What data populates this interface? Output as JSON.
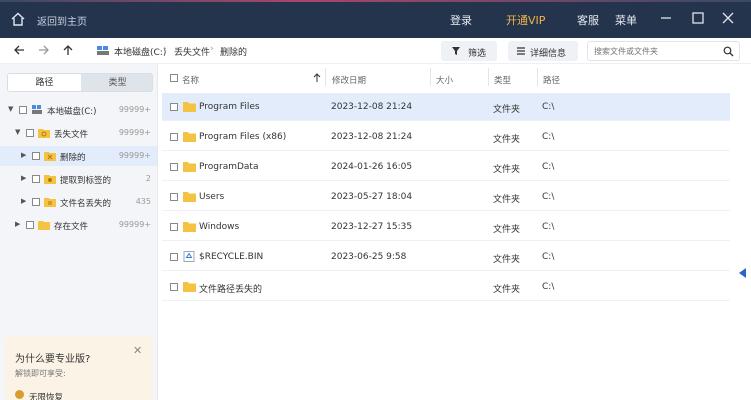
{
  "titlebar": {
    "back_label": "返回到主页",
    "login": "登录",
    "vip": "开通VIP",
    "service": "客服",
    "menu": "菜单"
  },
  "toolbar": {
    "breadcrumbs": [
      "本地磁盘(C:)",
      "丢失文件",
      "删除的"
    ],
    "filter_label": "筛选",
    "details_label": "详细信息",
    "search_placeholder": "搜索文件或文件夹"
  },
  "sidebar": {
    "tabs": [
      "路径",
      "类型"
    ],
    "tree": [
      {
        "label": "本地磁盘(C:)",
        "count": "99999+"
      },
      {
        "label": "丢失文件",
        "count": "99999+"
      },
      {
        "label": "删除的",
        "count": "99999+"
      },
      {
        "label": "提取到标签的",
        "count": "2"
      },
      {
        "label": "文件名丢失的",
        "count": "435"
      },
      {
        "label": "存在文件",
        "count": "99999+"
      }
    ],
    "promo": {
      "title": "为什么要专业版?",
      "subtitle": "解锁即可享受:",
      "feature": "无限恢复"
    }
  },
  "file_list": {
    "columns": [
      "名称",
      "修改日期",
      "大小",
      "类型",
      "路径"
    ],
    "rows": [
      {
        "name": "Program Files",
        "modified": "2023-12-08 21:24",
        "size": "",
        "type": "文件夹",
        "path": "C:\\"
      },
      {
        "name": "Program Files (x86)",
        "modified": "2023-12-08 21:24",
        "size": "",
        "type": "文件夹",
        "path": "C:\\"
      },
      {
        "name": "ProgramData",
        "modified": "2024-01-26 16:05",
        "size": "",
        "type": "文件夹",
        "path": "C:\\"
      },
      {
        "name": "Users",
        "modified": "2023-05-27 18:04",
        "size": "",
        "type": "文件夹",
        "path": "C:\\"
      },
      {
        "name": "Windows",
        "modified": "2023-12-27 15:35",
        "size": "",
        "type": "文件夹",
        "path": "C:\\"
      },
      {
        "name": "$RECYCLE.BIN",
        "modified": "2023-06-25 9:58",
        "size": "",
        "type": "文件夹",
        "path": "C:\\"
      },
      {
        "name": "文件路径丢失的",
        "modified": "",
        "size": "",
        "type": "文件夹",
        "path": "C:\\"
      }
    ]
  },
  "colors": {
    "titlebar_bg": "#24344d",
    "vip": "#f2b34a",
    "selection": "#e3ecfb",
    "folder": "#f5c342"
  }
}
